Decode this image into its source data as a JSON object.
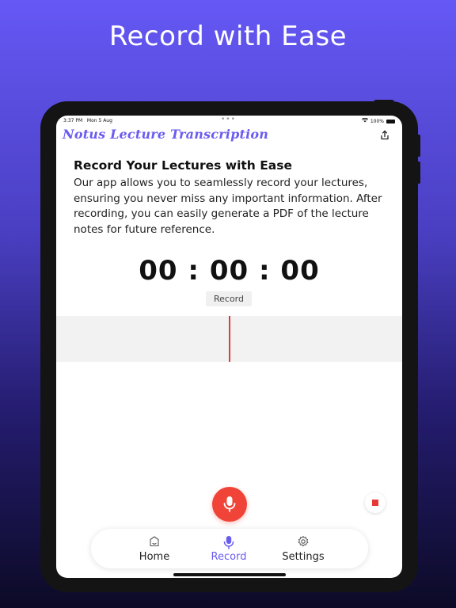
{
  "headline": "Record with Ease",
  "status_bar": {
    "time": "3:37 PM",
    "date": "Mon 5 Aug",
    "battery": "100%"
  },
  "app": {
    "title": "Notus Lecture Transcription"
  },
  "content": {
    "section_title": "Record Your Lectures with Ease",
    "description": "Our app allows you to seamlessly record your lectures, ensuring you never miss any important information. After recording, you can easily generate a PDF of the lecture notes for future reference.",
    "timer": "00 : 00 : 00",
    "record_label": "Record"
  },
  "tabs": [
    {
      "label": "Home",
      "icon": "home-icon"
    },
    {
      "label": "Record",
      "icon": "mic-icon",
      "active": true
    },
    {
      "label": "Settings",
      "icon": "gear-icon"
    }
  ],
  "colors": {
    "accent": "#6a5cf0",
    "record_red": "#f04438",
    "stop_red": "#e53935",
    "playhead": "#e0393e"
  }
}
